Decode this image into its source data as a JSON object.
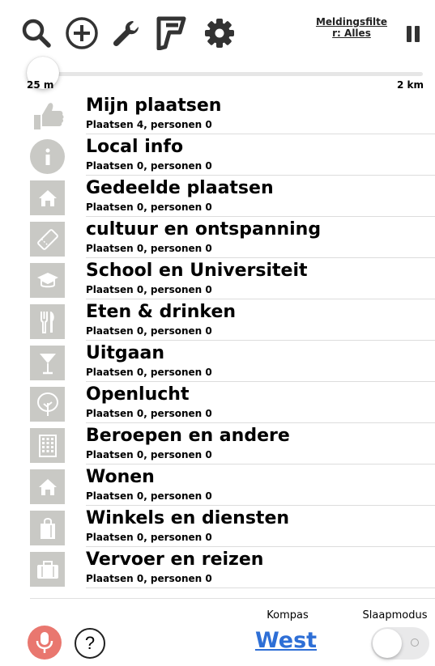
{
  "toolbar": {
    "filter_label": "Meldingsfilter: Alles",
    "icons": [
      "search-icon",
      "add-circle-icon",
      "wrench-icon",
      "foursquare-icon",
      "gear-icon",
      "pause-icon"
    ]
  },
  "radius_slider": {
    "min_label": "25 m",
    "max_label": "2 km",
    "value_fraction": 0.0
  },
  "categories": [
    {
      "title": "Mijn plaatsen",
      "subtitle": "Plaatsen 4, personen 0",
      "icon": "thumbs-up-icon"
    },
    {
      "title": "Local info",
      "subtitle": "Plaatsen 0, personen 0",
      "icon": "info-icon"
    },
    {
      "title": "Gedeelde plaatsen",
      "subtitle": "Plaatsen 0, personen 0",
      "icon": "home-icon"
    },
    {
      "title": "cultuur en ontspanning",
      "subtitle": "Plaatsen 0, personen 0",
      "icon": "ticket-icon"
    },
    {
      "title": "School en Universiteit",
      "subtitle": "Plaatsen 0, personen 0",
      "icon": "graduation-cap-icon"
    },
    {
      "title": "Eten & drinken",
      "subtitle": "Plaatsen 0, personen 0",
      "icon": "fork-knife-icon"
    },
    {
      "title": "Uitgaan",
      "subtitle": "Plaatsen 0, personen 0",
      "icon": "cocktail-icon"
    },
    {
      "title": "Openlucht",
      "subtitle": "Plaatsen 0, personen 0",
      "icon": "tree-icon"
    },
    {
      "title": "Beroepen en andere",
      "subtitle": "Plaatsen 0, personen 0",
      "icon": "building-icon"
    },
    {
      "title": "Wonen",
      "subtitle": "Plaatsen 0, personen 0",
      "icon": "house-icon"
    },
    {
      "title": "Winkels en diensten",
      "subtitle": "Plaatsen 0, personen 0",
      "icon": "shopping-bag-icon"
    },
    {
      "title": "Vervoer en reizen",
      "subtitle": "Plaatsen 0, personen 0",
      "icon": "suitcase-icon"
    }
  ],
  "footer": {
    "compass_label": "Kompas",
    "compass_value": "West",
    "sleep_label": "Slaapmodus",
    "sleep_on": false,
    "help_symbol": "?"
  },
  "colors": {
    "accent": "#2e6fd6",
    "mic": "#e9776f",
    "category_icon_bg": "#c9c9c5"
  }
}
